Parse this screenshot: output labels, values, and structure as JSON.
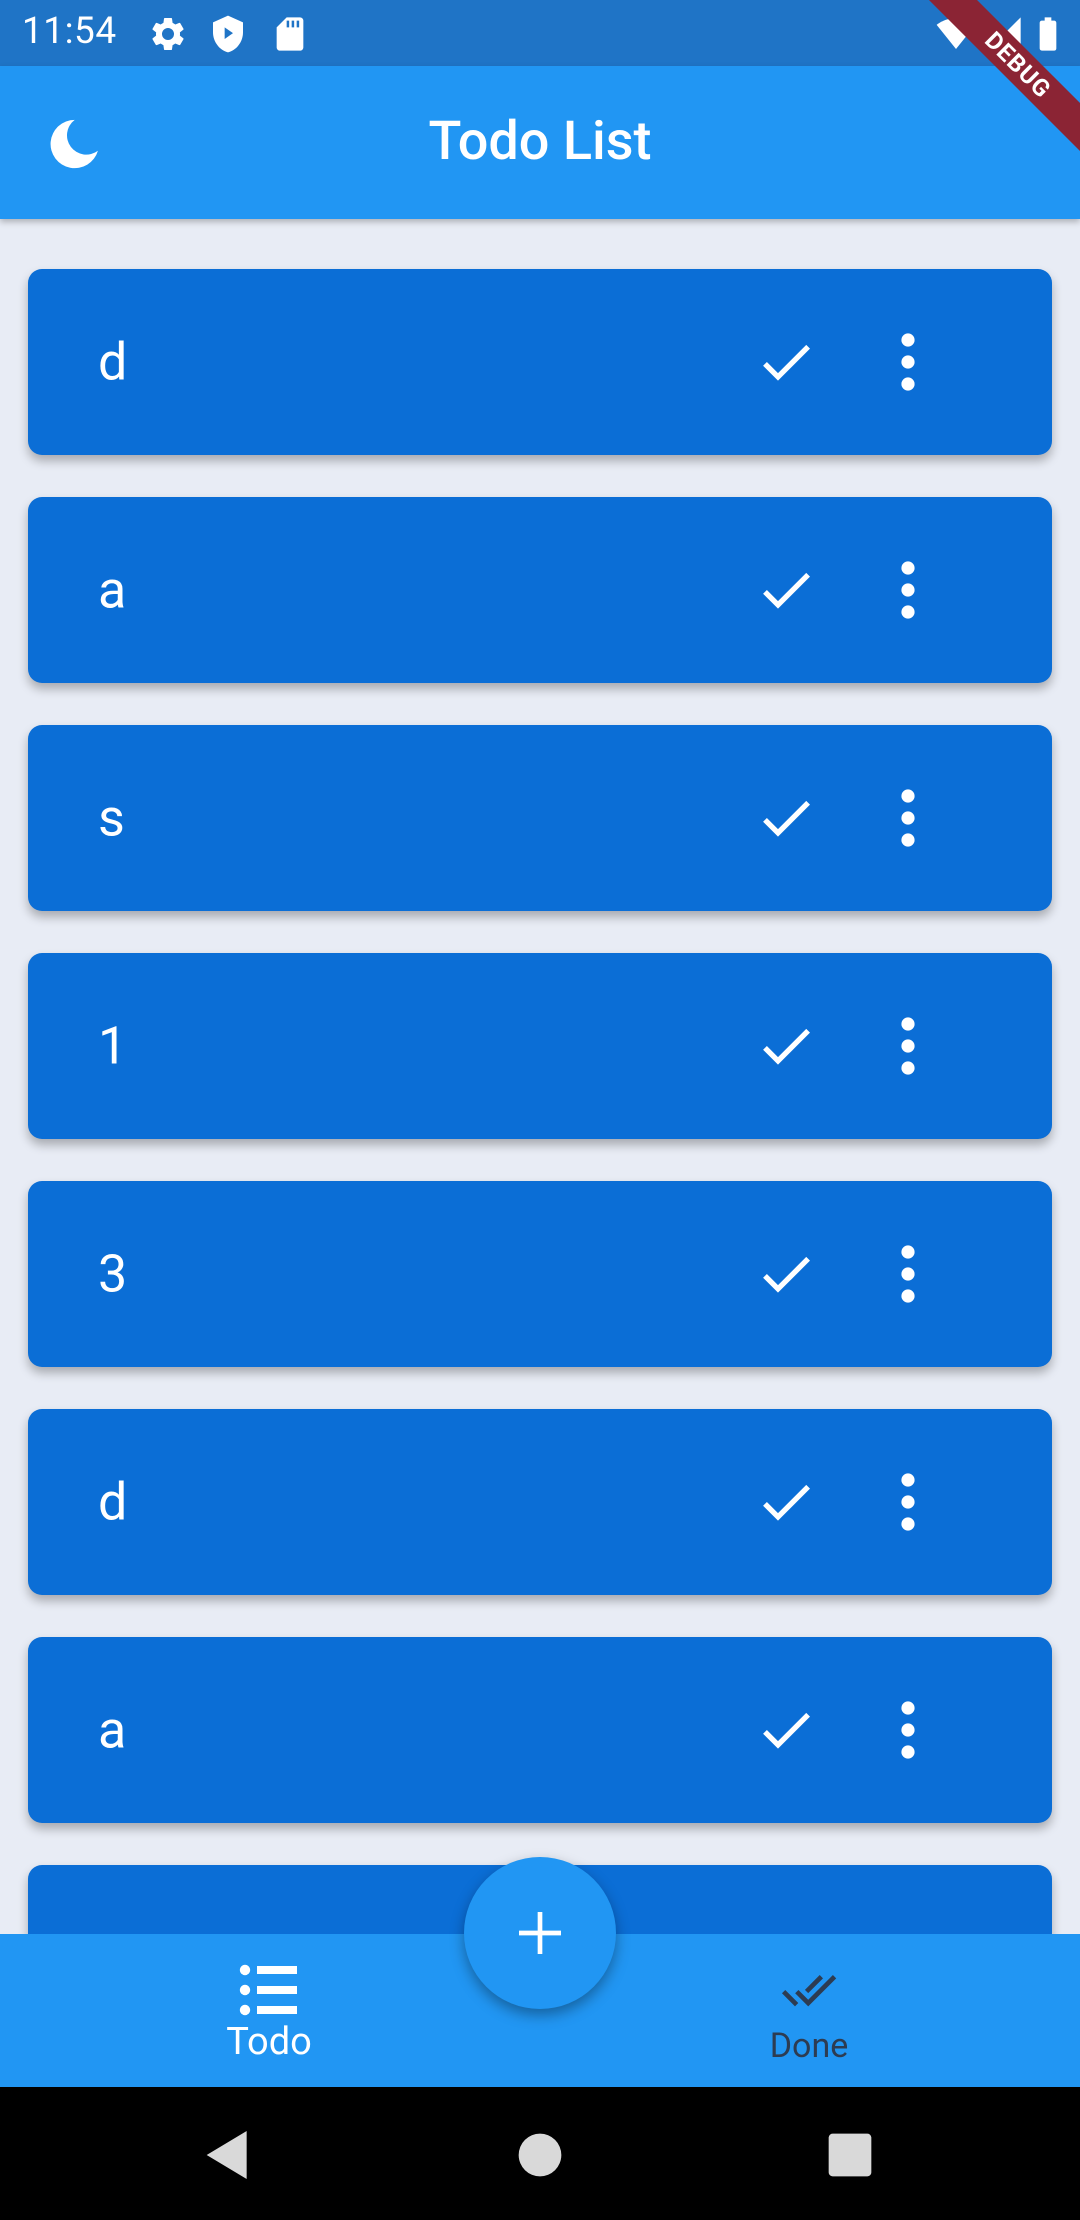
{
  "status_bar": {
    "time": "11:54",
    "icons": [
      "settings-icon",
      "shield-play-icon",
      "sd-card-icon",
      "wifi-icon",
      "signal-icon",
      "battery-icon"
    ]
  },
  "debug_banner": "DEBUG",
  "app_bar": {
    "title": "Todo List",
    "theme_toggle_icon": "moon-icon"
  },
  "todos": [
    {
      "title": "d"
    },
    {
      "title": "a"
    },
    {
      "title": "s"
    },
    {
      "title": "1"
    },
    {
      "title": "3"
    },
    {
      "title": "d"
    },
    {
      "title": "a"
    },
    {
      "title": ""
    }
  ],
  "fab": {
    "icon": "plus-icon"
  },
  "bottom_nav": {
    "todo_label": "Todo",
    "done_label": "Done",
    "selected": "Todo"
  },
  "system_nav": [
    "back-icon",
    "home-icon",
    "recents-icon"
  ],
  "colors": {
    "primary": "#2196f3",
    "status_bar": "#1f74c6",
    "card": "#0b6ed6",
    "background": "#e8ecf5",
    "debug": "#8b2434"
  }
}
